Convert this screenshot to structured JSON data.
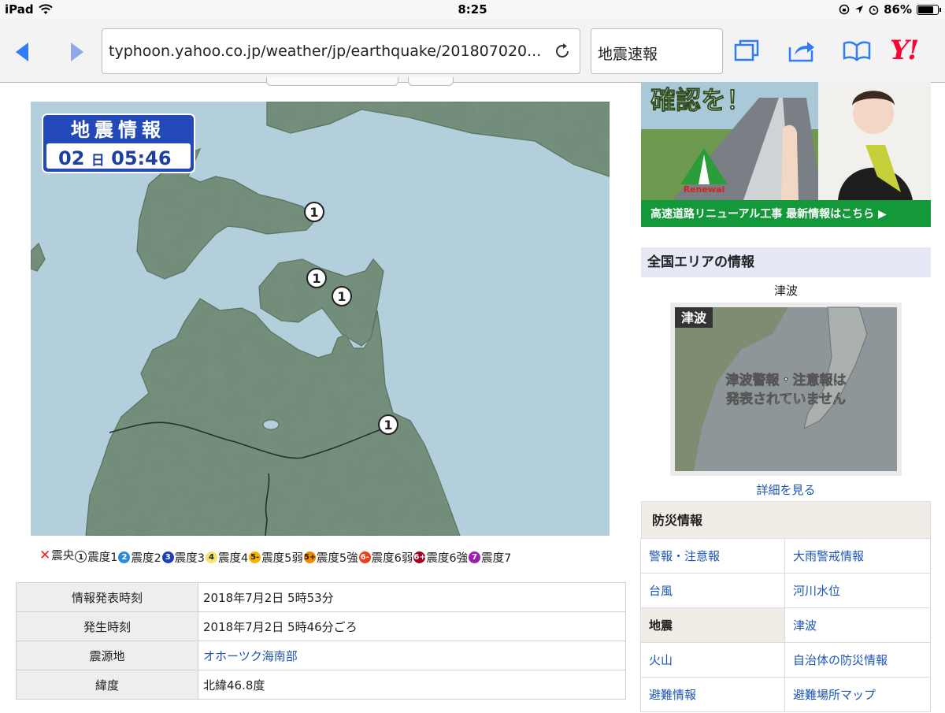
{
  "status_bar": {
    "device": "iPad",
    "time": "8:25",
    "battery": "86%",
    "battery_level": 0.86
  },
  "browser": {
    "url": "typhoon.yahoo.co.jp/weather/jp/earthquake/201807020...",
    "search_text": "地震速報",
    "logo": "Y!"
  },
  "map": {
    "badge_title": "地震情報",
    "badge_day": "02",
    "badge_day_unit": "日",
    "badge_time": "05:46",
    "markers": [
      {
        "label": "1"
      },
      {
        "label": "1"
      },
      {
        "label": "1"
      },
      {
        "label": "1"
      }
    ]
  },
  "legend": [
    {
      "symbol": "✕",
      "label": "震央",
      "color": "#e8231b"
    },
    {
      "symbol": "1",
      "label": "震度1",
      "color": "#ffffff"
    },
    {
      "symbol": "2",
      "label": "震度2",
      "color": "#2d8ad6"
    },
    {
      "symbol": "3",
      "label": "震度3",
      "color": "#1f3fb4"
    },
    {
      "symbol": "4",
      "label": "震度4",
      "color": "#f6e46b"
    },
    {
      "symbol": "5-",
      "label": "震度5弱",
      "color": "#f4b400"
    },
    {
      "symbol": "5+",
      "label": "震度5強",
      "color": "#f08a00"
    },
    {
      "symbol": "6-",
      "label": "震度6弱",
      "color": "#e6401c"
    },
    {
      "symbol": "6+",
      "label": "震度6強",
      "color": "#a3001f"
    },
    {
      "symbol": "7",
      "label": "震度7",
      "color": "#9b1fb0"
    }
  ],
  "info_table": [
    {
      "key": "情報発表時刻",
      "value": "2018年7月2日 5時53分"
    },
    {
      "key": "発生時刻",
      "value": "2018年7月2日 5時46分ごろ"
    },
    {
      "key": "震源地",
      "value": "オホーツク海南部",
      "link": true
    },
    {
      "key": "緯度",
      "value": "北緯46.8度"
    }
  ],
  "banner": {
    "headline": "確認を！",
    "logo_text": "Renewal",
    "footer": "高速道路リニューアル工事 最新情報はこちら ▶"
  },
  "area_info": {
    "header": "全国エリアの情報",
    "tsunami_title": "津波",
    "tsunami_tag": "津波",
    "tsunami_message_1": "津波警報・注意報は",
    "tsunami_message_2": "発表されていません",
    "detail_link": "詳細を見る"
  },
  "disaster_info": {
    "header": "防災情報",
    "items": [
      {
        "label": "警報・注意報"
      },
      {
        "label": "大雨警戒情報"
      },
      {
        "label": "台風"
      },
      {
        "label": "河川水位"
      },
      {
        "label": "地震",
        "active": true
      },
      {
        "label": "津波"
      },
      {
        "label": "火山"
      },
      {
        "label": "自治体の防災情報"
      },
      {
        "label": "避難情報"
      },
      {
        "label": "避難場所マップ"
      }
    ]
  }
}
